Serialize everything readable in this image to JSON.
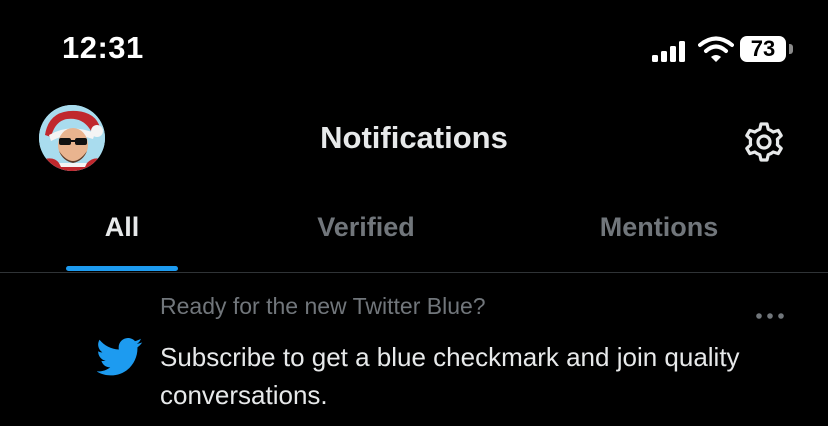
{
  "status_bar": {
    "time": "12:31",
    "battery": "73",
    "icons": [
      "signal-icon",
      "wifi-icon",
      "battery-icon"
    ]
  },
  "header": {
    "title": "Notifications",
    "icons": [
      "avatar",
      "gear-icon"
    ]
  },
  "tabs": [
    {
      "label": "All",
      "selected": true
    },
    {
      "label": "Verified",
      "selected": false
    },
    {
      "label": "Mentions",
      "selected": false
    }
  ],
  "notification": {
    "subtitle": "Ready for the new Twitter Blue?",
    "body": "Subscribe to get a blue checkmark and join quality conversations.",
    "icons": [
      "twitter-bird-icon",
      "more-icon"
    ]
  },
  "colors": {
    "background": "#000000",
    "accent": "#1d9bf0",
    "text_primary": "#e7e9ea",
    "text_secondary": "#71767b",
    "divider": "#2f3336"
  }
}
